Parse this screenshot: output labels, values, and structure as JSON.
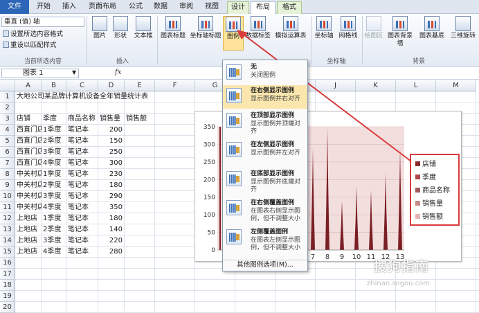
{
  "tabs": [
    "文件",
    "开始",
    "插入",
    "页面布局",
    "公式",
    "数据",
    "审阅",
    "视图",
    "设计",
    "布局",
    "格式"
  ],
  "active_tab": "布局",
  "ribbon": {
    "selection_box": "垂直 (值) 轴",
    "format_selection": "设置所选内容格式",
    "reset_style": "重设以匹配样式",
    "group_current": "当前所选内容",
    "group_insert": "插入",
    "group_axis": "坐标轴",
    "group_background": "背景",
    "buttons": {
      "picture": "图片",
      "shapes": "形状",
      "textbox": "文本框",
      "chart_title": "图表标题",
      "axis_titles": "坐标轴标题",
      "legend": "图例",
      "data_labels": "数据标签",
      "data_table": "模拟运算表",
      "axes": "坐标轴",
      "gridlines": "网格线",
      "plot_area": "绘图区",
      "chart_wall": "图表背景墙",
      "chart_floor": "图表基底",
      "rotation_3d": "三维旋转"
    }
  },
  "formula_bar": {
    "name_box": "图表 1",
    "fx": "fx"
  },
  "sheet": {
    "columns": [
      "A",
      "B",
      "C",
      "D",
      "E",
      "F",
      "G",
      "H",
      "I",
      "J",
      "K",
      "L",
      "M"
    ],
    "rows": [
      "1",
      "2",
      "3",
      "4",
      "5",
      "6",
      "7",
      "8",
      "9",
      "10",
      "11",
      "12",
      "13",
      "14",
      "15",
      "16",
      "17",
      "18",
      "19",
      "20"
    ],
    "title": "大地公司某品牌计算机设备全年销量统计表",
    "headers": [
      "店铺",
      "季度",
      "商品名称",
      "销售量",
      "销售额"
    ],
    "data": [
      [
        "西直门店",
        "1季度",
        "笔记本",
        "200"
      ],
      [
        "西直门店",
        "2季度",
        "笔记本",
        "150"
      ],
      [
        "西直门店",
        "3季度",
        "笔记本",
        "250"
      ],
      [
        "西直门店",
        "4季度",
        "笔记本",
        "300"
      ],
      [
        "中关村店",
        "1季度",
        "笔记本",
        "230"
      ],
      [
        "中关村店",
        "2季度",
        "笔记本",
        "180"
      ],
      [
        "中关村店",
        "3季度",
        "笔记本",
        "290"
      ],
      [
        "中关村店",
        "4季度",
        "笔记本",
        "350"
      ],
      [
        "上地店",
        "1季度",
        "笔记本",
        "180"
      ],
      [
        "上地店",
        "2季度",
        "笔记本",
        "140"
      ],
      [
        "上地店",
        "3季度",
        "笔记本",
        "220"
      ],
      [
        "上地店",
        "4季度",
        "笔记本",
        "280"
      ]
    ]
  },
  "chart_data": {
    "type": "area",
    "x": [
      "7",
      "8",
      "9",
      "10",
      "11",
      "12",
      "13"
    ],
    "y_ticks_visible": [
      "350",
      "300",
      "250",
      "200",
      "150",
      "100",
      "50",
      "0"
    ],
    "ylim": [
      0,
      350
    ],
    "peaks": [
      290,
      350,
      140,
      180,
      170,
      220,
      290
    ],
    "legend": [
      "店铺",
      "季度",
      "商品名称",
      "销售量",
      "销售额"
    ],
    "legend_colors": [
      "#8b2b2b",
      "#b0464a",
      "#a05a5a",
      "#c98a8a",
      "#e8b5b5"
    ],
    "series_color": "#7a1f24",
    "plot_bg": "#f3dede"
  },
  "menu": {
    "items": [
      {
        "title": "无",
        "desc": "关闭图例"
      },
      {
        "title": "在右侧显示图例",
        "desc": "显示图例并右对齐"
      },
      {
        "title": "在顶部显示图例",
        "desc": "显示图例并顶端对齐"
      },
      {
        "title": "在左侧显示图例",
        "desc": "显示图例并左对齐"
      },
      {
        "title": "在底部显示图例",
        "desc": "显示图例并底端对齐"
      },
      {
        "title": "在右侧覆盖图例",
        "desc": "在图表右侧显示图例，但不调整大小"
      },
      {
        "title": "左侧覆盖图例",
        "desc": "在图表左侧显示图例，但不调整大小"
      }
    ],
    "more_options": "其他图例选项(M)..."
  },
  "watermark": {
    "brand": "搜狗指南",
    "url": "zhinan.sogou.com"
  },
  "accent_color": "#d93a3a"
}
